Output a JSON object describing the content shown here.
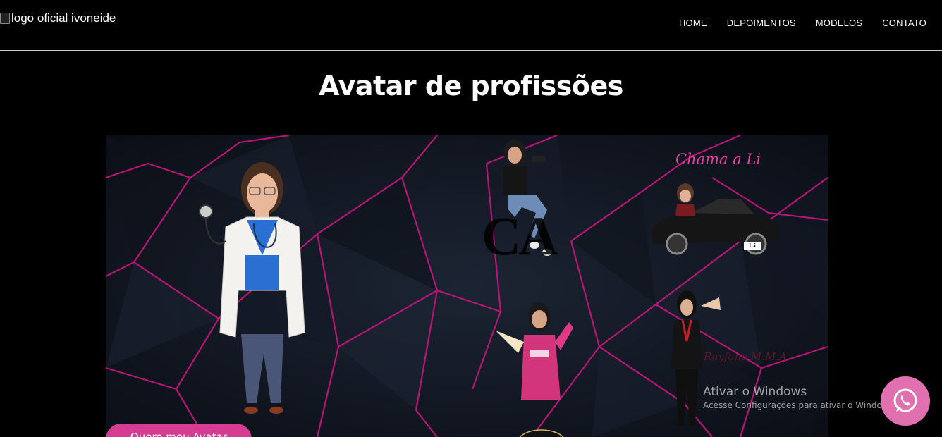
{
  "header": {
    "logo_alt": "logo oficial ivoneide",
    "nav": [
      {
        "label": "HOME"
      },
      {
        "label": "DEPOIMENTOS"
      },
      {
        "label": "MODELOS"
      },
      {
        "label": "CONTATO"
      }
    ]
  },
  "section": {
    "title": "Avatar de profissões"
  },
  "gallery": {
    "script_text": "Chama a Li",
    "watermark_letters": "CA",
    "plate_text": "L.i",
    "signature": "Rayfana M.M.A"
  },
  "cta": {
    "label": "Quero meu Avatar"
  },
  "windows_watermark": {
    "line1": "Ativar o Windows",
    "line2": "Acesse Configurações para ativar o Windows."
  },
  "colors": {
    "accent": "#d63d92",
    "whatsapp_button": "#e170b0",
    "neon_line": "#c0157a",
    "background": "#000000"
  },
  "icons": {
    "whatsapp": "whatsapp-icon",
    "broken_logo": "broken-image-icon"
  }
}
